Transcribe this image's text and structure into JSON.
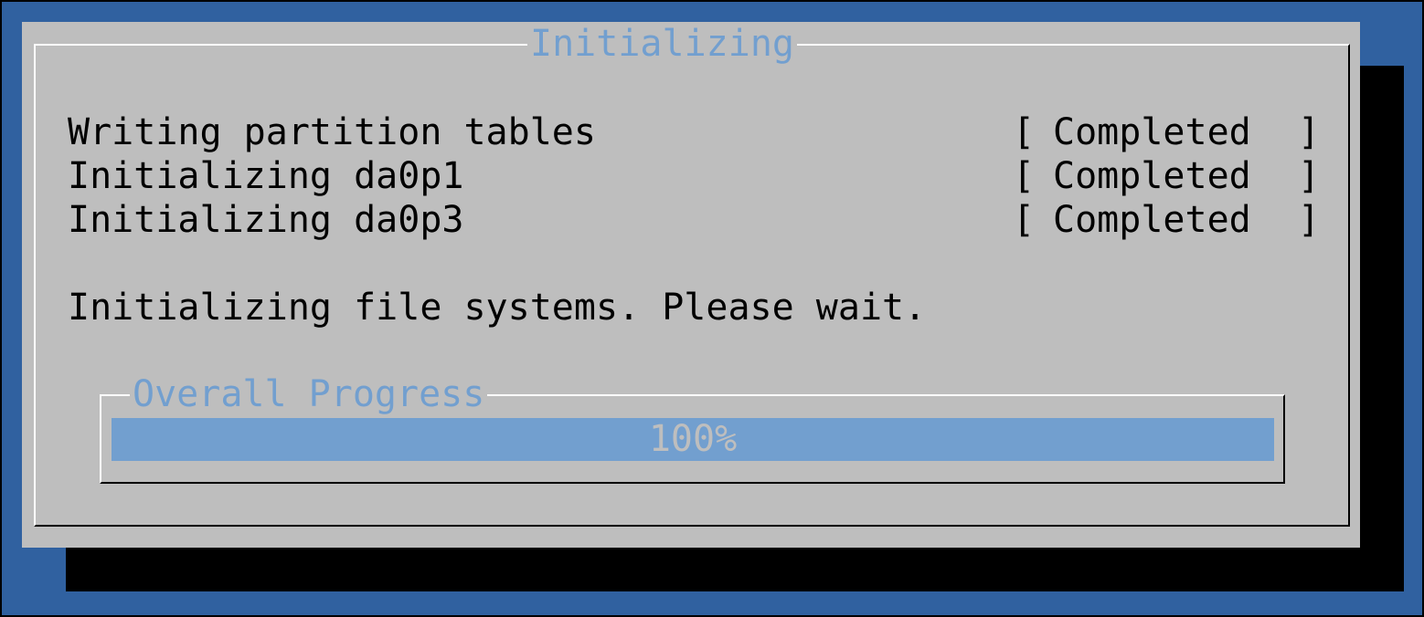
{
  "dialog": {
    "title": "Initializing"
  },
  "tasks": [
    {
      "label": "Writing partition tables",
      "open": "[",
      "status": "Completed",
      "close": "]"
    },
    {
      "label": "Initializing da0p1",
      "open": "[",
      "status": "Completed",
      "close": "]"
    },
    {
      "label": "Initializing da0p3",
      "open": "[",
      "status": "Completed",
      "close": "]"
    }
  ],
  "message": "Initializing file systems. Please wait.",
  "progress": {
    "title": "Overall Progress",
    "value_text": "100%",
    "fraction": 1.0
  },
  "colors": {
    "background": "#3061a0",
    "dialog": "#bebebe",
    "accent": "#729fcf",
    "shadow": "#000000"
  }
}
